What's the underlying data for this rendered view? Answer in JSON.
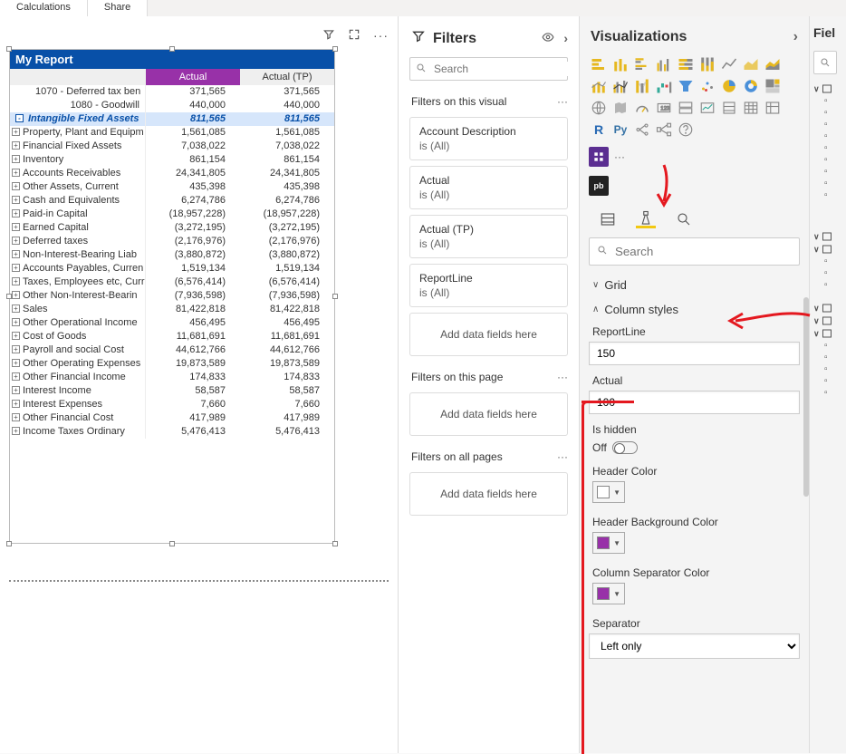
{
  "top_tabs": {
    "calculations": "Calculations",
    "share": "Share"
  },
  "canvas": {
    "visual_title": "My Report",
    "columns": {
      "blank": "",
      "actual": "Actual",
      "actual_tp": "Actual (TP)"
    },
    "toolbar": {
      "filter": "filter",
      "focus": "focus",
      "more": "..."
    }
  },
  "rows": [
    {
      "label": "1070 - Deferred tax ben",
      "v1": "371,565",
      "v2": "371,565",
      "raw": true
    },
    {
      "label": "1080 - Goodwill",
      "v1": "440,000",
      "v2": "440,000",
      "raw": true
    },
    {
      "label": "Intangible Fixed Assets",
      "v1": "811,565",
      "v2": "811,565",
      "hl": true,
      "expand": "-"
    },
    {
      "label": "Property, Plant and Equipm",
      "v1": "1,561,085",
      "v2": "1,561,085",
      "expand": "+"
    },
    {
      "label": "Financial Fixed Assets",
      "v1": "7,038,022",
      "v2": "7,038,022",
      "expand": "+"
    },
    {
      "label": "Inventory",
      "v1": "861,154",
      "v2": "861,154",
      "expand": "+"
    },
    {
      "label": "Accounts Receivables",
      "v1": "24,341,805",
      "v2": "24,341,805",
      "expand": "+"
    },
    {
      "label": "Other Assets, Current",
      "v1": "435,398",
      "v2": "435,398",
      "expand": "+"
    },
    {
      "label": "Cash and Equivalents",
      "v1": "6,274,786",
      "v2": "6,274,786",
      "expand": "+"
    },
    {
      "label": "Paid-in Capital",
      "v1": "(18,957,228)",
      "v2": "(18,957,228)",
      "expand": "+"
    },
    {
      "label": "Earned Capital",
      "v1": "(3,272,195)",
      "v2": "(3,272,195)",
      "expand": "+"
    },
    {
      "label": "Deferred taxes",
      "v1": "(2,176,976)",
      "v2": "(2,176,976)",
      "expand": "+"
    },
    {
      "label": "Non-Interest-Bearing Liab",
      "v1": "(3,880,872)",
      "v2": "(3,880,872)",
      "expand": "+"
    },
    {
      "label": "Accounts Payables, Curren",
      "v1": "1,519,134",
      "v2": "1,519,134",
      "expand": "+"
    },
    {
      "label": "Taxes, Employees etc, Curr",
      "v1": "(6,576,414)",
      "v2": "(6,576,414)",
      "expand": "+"
    },
    {
      "label": "Other Non-Interest-Bearin",
      "v1": "(7,936,598)",
      "v2": "(7,936,598)",
      "expand": "+"
    },
    {
      "label": "Sales",
      "v1": "81,422,818",
      "v2": "81,422,818",
      "expand": "+"
    },
    {
      "label": "Other Operational Income",
      "v1": "456,495",
      "v2": "456,495",
      "expand": "+"
    },
    {
      "label": "Cost of Goods",
      "v1": "11,681,691",
      "v2": "11,681,691",
      "expand": "+"
    },
    {
      "label": "Payroll and social Cost",
      "v1": "44,612,766",
      "v2": "44,612,766",
      "expand": "+"
    },
    {
      "label": "Other Operating Expenses",
      "v1": "19,873,589",
      "v2": "19,873,589",
      "expand": "+"
    },
    {
      "label": "Other Financial Income",
      "v1": "174,833",
      "v2": "174,833",
      "expand": "+"
    },
    {
      "label": "Interest Income",
      "v1": "58,587",
      "v2": "58,587",
      "expand": "+"
    },
    {
      "label": "Interest Expenses",
      "v1": "7,660",
      "v2": "7,660",
      "expand": "+"
    },
    {
      "label": "Other Financial Cost",
      "v1": "417,989",
      "v2": "417,989",
      "expand": "+"
    },
    {
      "label": "Income Taxes Ordinary",
      "v1": "5,476,413",
      "v2": "5,476,413",
      "expand": "+"
    }
  ],
  "filters": {
    "title": "Filters",
    "search_placeholder": "Search",
    "visual_h": "Filters on this visual",
    "page_h": "Filters on this page",
    "all_h": "Filters on all pages",
    "add": "Add data fields here",
    "is_all": "is (All)",
    "cards": [
      "Account Description",
      "Actual",
      "Actual (TP)",
      "ReportLine"
    ]
  },
  "vispane": {
    "title": "Visualizations",
    "search_placeholder": "Search",
    "tabs": {
      "fields": "fields",
      "format": "format",
      "analytics": "analytics"
    },
    "grid": "Grid",
    "column_styles": "Column styles",
    "reportline_label": "ReportLine",
    "reportline_value": "150",
    "actual_label": "Actual",
    "actual_value": "100",
    "is_hidden": "Is hidden",
    "off": "Off",
    "header_color": "Header Color",
    "header_bg": "Header Background Color",
    "col_sep_color": "Column Separator Color",
    "separator": "Separator",
    "separator_value": "Left only",
    "custom1": "custom-visual-1",
    "more": "..."
  },
  "colors": {
    "header_color": "#ffffff",
    "header_bg": "#9831a8",
    "col_sep": "#9831a8"
  },
  "fields": {
    "title": "Fiel"
  }
}
